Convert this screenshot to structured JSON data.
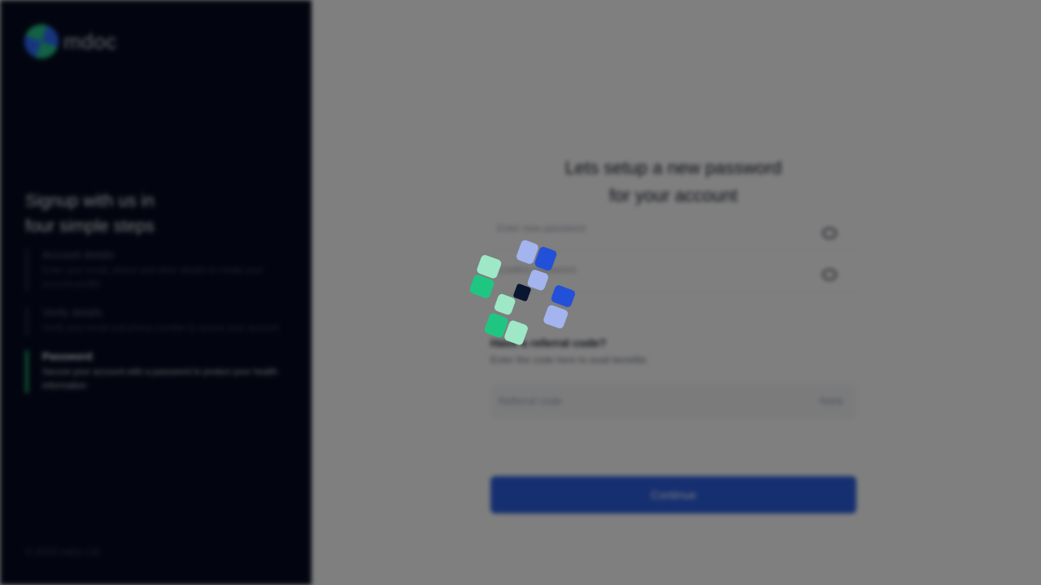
{
  "brand": {
    "name": "mdoc"
  },
  "sidebar": {
    "title_line1": "Signup with us in",
    "title_line2": "four simple steps",
    "steps": [
      {
        "title": "Account details",
        "desc": "Enter your email, phone and other details to create your account profile"
      },
      {
        "title": "Verify details",
        "desc": "Verify your email and phone number to secure your account"
      },
      {
        "title": "Password",
        "desc": "Secure your account with a password to protect your health information"
      }
    ],
    "copyright": "© 2024 mdoc Ltd"
  },
  "form": {
    "title_line1": "Lets setup a new password",
    "title_line2": "for your account",
    "new_password_placeholder": "Enter new password",
    "confirm_password_placeholder": "Confirm password",
    "code_heading": "Have a referral code?",
    "code_subtext": "Enter the code here to avail benefits",
    "code_placeholder": "Referral code",
    "resend_label": "Apply",
    "continue_label": "Continue"
  },
  "colors": {
    "sidebar_bg": "#050b1f",
    "accent_green": "#1fa86a",
    "primary_blue": "#2b5fe0",
    "spinner_light_blue": "#a3b4ee",
    "spinner_blue": "#2350d8",
    "spinner_light_green": "#9ee8c8",
    "spinner_green": "#1fc682",
    "spinner_center": "#0a1630"
  },
  "spinner": {
    "icon": "loading-spinner-icon"
  }
}
